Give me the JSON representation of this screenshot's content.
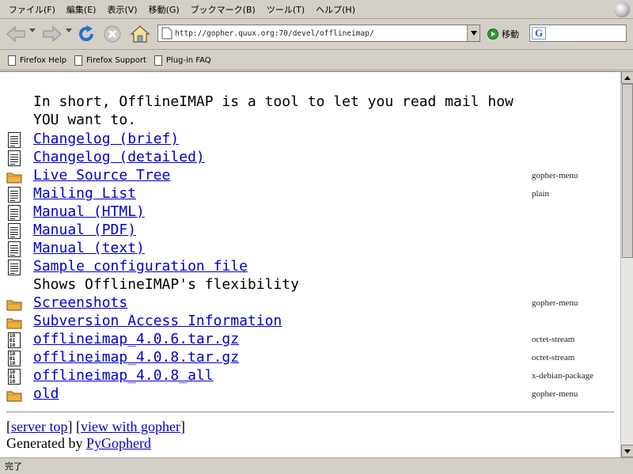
{
  "menu": [
    "ファイル(F)",
    "編集(E)",
    "表示(V)",
    "移動(G)",
    "ブックマーク(B)",
    "ツール(T)",
    "ヘルプ(H)"
  ],
  "toolbar": {
    "back_icon": "back-arrow-icon",
    "forward_icon": "forward-arrow-icon",
    "reload_icon": "reload-icon",
    "stop_icon": "stop-icon",
    "home_icon": "home-icon",
    "url": "http://gopher.quux.org:70/devel/offlineimap/",
    "go_label": "移動",
    "search_logo": "G"
  },
  "bookmarks": [
    "Firefox Help",
    "Firefox Support",
    "Plug-in FAQ"
  ],
  "content": {
    "intro_line1": "In short, OfflineIMAP is a tool to let you read mail how",
    "intro_line2": "YOU want to.",
    "items": [
      {
        "kind": "doc",
        "title": "Changelog (brief)",
        "type": ""
      },
      {
        "kind": "doc",
        "title": "Changelog (detailed)",
        "type": ""
      },
      {
        "kind": "folder",
        "title": "Live Source Tree",
        "type": "gopher-menu"
      },
      {
        "kind": "doc",
        "title": "Mailing List",
        "type": "plain"
      },
      {
        "kind": "doc",
        "title": "Manual (HTML)",
        "type": ""
      },
      {
        "kind": "doc",
        "title": "Manual (PDF)",
        "type": ""
      },
      {
        "kind": "doc",
        "title": "Manual (text)",
        "type": ""
      },
      {
        "kind": "doc",
        "title": "Sample configuration file",
        "type": ""
      },
      {
        "kind": "info",
        "title": "Shows OfflineIMAP's flexibility",
        "type": ""
      },
      {
        "kind": "folder",
        "title": "Screenshots",
        "type": "gopher-menu"
      },
      {
        "kind": "folder",
        "title": "Subversion Access Information",
        "type": ""
      },
      {
        "kind": "bin",
        "title": "offlineimap_4.0.6.tar.gz",
        "type": "octet-stream"
      },
      {
        "kind": "bin",
        "title": "offlineimap_4.0.8.tar.gz",
        "type": "octet-stream"
      },
      {
        "kind": "bin",
        "title": "offlineimap_4.0.8_all",
        "type": "x-debian-package"
      },
      {
        "kind": "folder",
        "title": "old",
        "type": "gopher-menu"
      }
    ],
    "footer": {
      "bracket_open1": "[",
      "server_top": "server top",
      "bracket_mid": "] [",
      "view_with_gopher": "view with gopher",
      "bracket_close": "]",
      "generated_by": "Generated by ",
      "pygopherd": "PyGopherd"
    }
  },
  "status": "完了"
}
